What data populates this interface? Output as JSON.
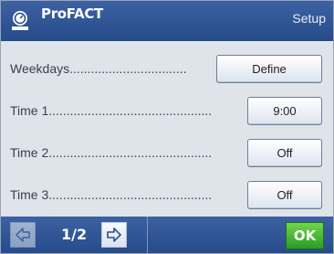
{
  "header": {
    "app_title": "ProFACT",
    "section": "Setup",
    "icon": "scale-icon"
  },
  "rows": [
    {
      "label": "Weekdays.................................",
      "value": "Define"
    },
    {
      "label": "Time 1............................................................",
      "value": "9:00"
    },
    {
      "label": "Time 2............................................................",
      "value": "Off"
    },
    {
      "label": "Time 3............................................................",
      "value": "Off"
    }
  ],
  "footer": {
    "page_indicator": "1/2",
    "prev_icon": "arrow-left-icon",
    "next_icon": "arrow-right-icon",
    "ok_label": "OK"
  },
  "colors": {
    "header_bg": "#305595",
    "panel_bg": "#dfe4ea",
    "ok_green": "#3cb92f"
  }
}
